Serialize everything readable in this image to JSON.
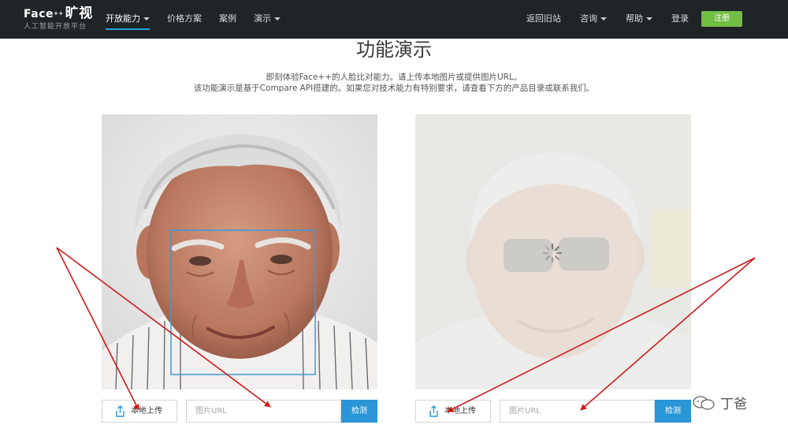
{
  "nav": {
    "logo_brand": "Face",
    "logo_plus": "++",
    "logo_cn": "旷视",
    "logo_sub": "人工智能开放平台",
    "items": [
      {
        "label": "开放能力",
        "has_caret": true,
        "active": true
      },
      {
        "label": "价格方案",
        "has_caret": false
      },
      {
        "label": "案例",
        "has_caret": false
      },
      {
        "label": "演示",
        "has_caret": true
      }
    ],
    "right_items": [
      {
        "label": "返回旧站"
      },
      {
        "label": "咨询",
        "has_caret": true
      },
      {
        "label": "帮助",
        "has_caret": true
      },
      {
        "label": "登录"
      }
    ],
    "register_label": "注册"
  },
  "page": {
    "title": "功能演示",
    "desc_line1": "即刻体验Face++的人脸比对能力。请上传本地图片或提供图片URL。",
    "desc_line2": "该功能演示是基于Compare API搭建的。如果您对技术能力有特别要求，请查看下方的产品目录或联系我们。"
  },
  "left_panel": {
    "upload_label": "本地上传",
    "url_placeholder": "图片URL",
    "detect_label": "检测"
  },
  "right_panel": {
    "upload_label": "本地上传",
    "url_placeholder": "图片URL",
    "detect_label": "检测",
    "state": "loading"
  },
  "watermark": {
    "text": "丁爸"
  },
  "colors": {
    "nav_bg": "#1f2426",
    "accent": "#2b96d6",
    "register": "#72bf44",
    "arrow": "#d11a1a"
  },
  "icons": {
    "upload": "upload-icon",
    "loading": "spinner-icon",
    "caret": "chevron-down-icon",
    "wechat": "wechat-icon"
  }
}
